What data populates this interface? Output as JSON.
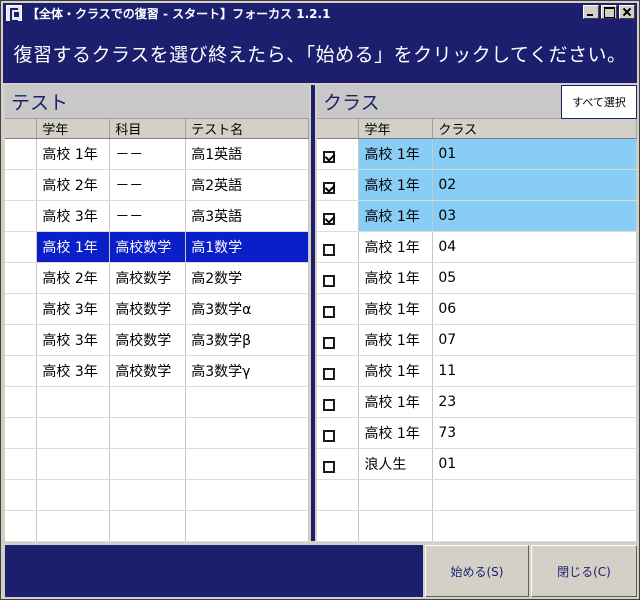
{
  "window": {
    "title": "【全体・クラスでの復習 - スタート】フォーカス 1.2.1"
  },
  "banner": {
    "text": "復習するクラスを選び終えたら、「始める」をクリックしてください。"
  },
  "tests_panel": {
    "title": "テスト",
    "columns": [
      "学年",
      "科目",
      "テスト名"
    ],
    "rows": [
      {
        "grade": "高校 1年",
        "subject": "－－",
        "name": "高1英語"
      },
      {
        "grade": "高校 2年",
        "subject": "－－",
        "name": "高2英語"
      },
      {
        "grade": "高校 3年",
        "subject": "－－",
        "name": "高3英語"
      },
      {
        "grade": "高校 1年",
        "subject": "高校数学",
        "name": "高1数学",
        "selected": true
      },
      {
        "grade": "高校 2年",
        "subject": "高校数学",
        "name": "高2数学"
      },
      {
        "grade": "高校 3年",
        "subject": "高校数学",
        "name": "高3数学α"
      },
      {
        "grade": "高校 3年",
        "subject": "高校数学",
        "name": "高3数学β"
      },
      {
        "grade": "高校 3年",
        "subject": "高校数学",
        "name": "高3数学γ"
      }
    ]
  },
  "classes_panel": {
    "title": "クラス",
    "select_all_label": "すべて選択",
    "columns": [
      "学年",
      "クラス"
    ],
    "rows": [
      {
        "grade": "高校 1年",
        "class": "01",
        "checked": true
      },
      {
        "grade": "高校 1年",
        "class": "02",
        "checked": true
      },
      {
        "grade": "高校 1年",
        "class": "03",
        "checked": true
      },
      {
        "grade": "高校 1年",
        "class": "04",
        "checked": false
      },
      {
        "grade": "高校 1年",
        "class": "05",
        "checked": false
      },
      {
        "grade": "高校 1年",
        "class": "06",
        "checked": false
      },
      {
        "grade": "高校 1年",
        "class": "07",
        "checked": false
      },
      {
        "grade": "高校 1年",
        "class": "11",
        "checked": false
      },
      {
        "grade": "高校 1年",
        "class": "23",
        "checked": false
      },
      {
        "grade": "高校 1年",
        "class": "73",
        "checked": false
      },
      {
        "grade": "浪人生",
        "class": "01",
        "checked": false
      }
    ]
  },
  "footer": {
    "start_label": "始める(S)",
    "close_label": "閉じる(C)"
  },
  "colors": {
    "navy": "#1b1f6e",
    "selection": "#0a1fc8",
    "checked_highlight": "#87cdf5"
  }
}
